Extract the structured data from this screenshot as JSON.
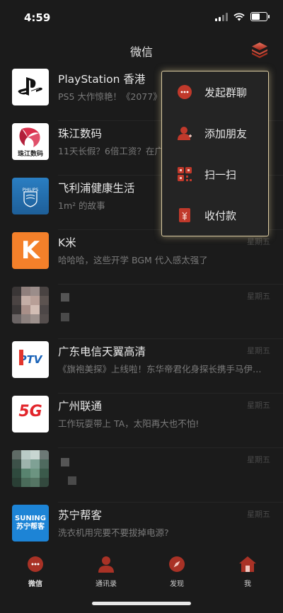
{
  "status_bar": {
    "time": "4:59"
  },
  "header": {
    "title": "微信"
  },
  "chats": [
    {
      "name": "PlayStation 香港",
      "snippet": "PS5 大作惊艳！《2077》",
      "time": ""
    },
    {
      "name": "珠江数码",
      "snippet": "11天长假？6倍工资？在广",
      "time": "",
      "avatar_text": "珠江数码"
    },
    {
      "name": "飞利浦健康生活",
      "snippet": "1m² 的故事",
      "time": "",
      "avatar_text": "PHILIPS"
    },
    {
      "name": "K米",
      "snippet": "哈哈哈，这些开学 BGM 代入感太强了",
      "time": "星期五",
      "avatar_text": "K"
    },
    {
      "name": "",
      "snippet": "",
      "time": "星期五"
    },
    {
      "name": "广东电信天翼高清",
      "snippet": "《旗袍美探》上线啦！东华帝君化身探长携手马伊…",
      "time": "星期五",
      "avatar_text": "PTV"
    },
    {
      "name": "广州联通",
      "snippet": "工作玩耍带上 TA，太阳再大也不怕!",
      "time": "星期五",
      "avatar_text": "5G"
    },
    {
      "name": "",
      "snippet": "",
      "time": "星期五"
    },
    {
      "name": "苏宁帮客",
      "snippet": "洗衣机用完要不要拔掉电源?",
      "time": "星期五",
      "avatar_text": "SUNING 苏宁帮客"
    }
  ],
  "menu": {
    "items": [
      {
        "label": "发起群聊",
        "icon": "chat-bubble-icon"
      },
      {
        "label": "添加朋友",
        "icon": "add-person-icon"
      },
      {
        "label": "扫一扫",
        "icon": "scan-icon"
      },
      {
        "label": "收付款",
        "icon": "payment-icon"
      }
    ]
  },
  "tabs": [
    {
      "label": "微信",
      "icon": "chat-bubble-icon",
      "active": true
    },
    {
      "label": "通讯录",
      "icon": "contacts-icon",
      "active": false
    },
    {
      "label": "发现",
      "icon": "compass-icon",
      "active": false
    },
    {
      "label": "我",
      "icon": "home-icon",
      "active": false
    }
  ],
  "colors": {
    "accent": "#c0392b",
    "menu_border": "#d8c9a0",
    "background": "#1b1b1b"
  }
}
